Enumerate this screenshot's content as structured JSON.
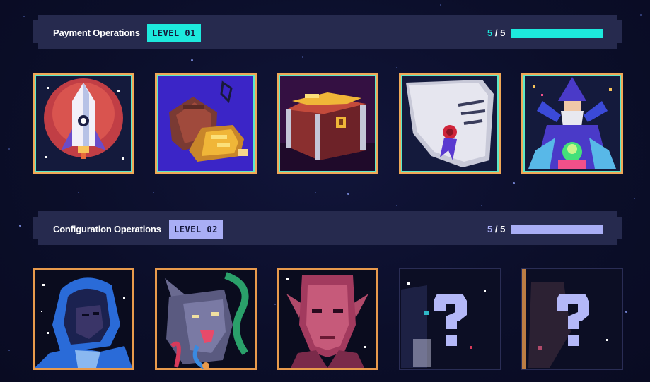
{
  "colors": {
    "background": "#0c0f2c",
    "bar": "#262a4e",
    "level1_accent": "#1de9dd",
    "level2_accent": "#a9aef5",
    "card_border_orange": "#e89a4c"
  },
  "sections": [
    {
      "title": "Payment Operations",
      "level_label": "LEVEL 01",
      "progress_current": "5",
      "progress_total": "/ 5",
      "progress_fraction": 1.0,
      "cards": [
        {
          "icon": "rocket-icon"
        },
        {
          "icon": "bag-of-gold-icon"
        },
        {
          "icon": "treasure-chest-icon"
        },
        {
          "icon": "scroll-icon"
        },
        {
          "icon": "wizard-icon"
        }
      ]
    },
    {
      "title": "Configuration Operations",
      "level_label": "LEVEL 02",
      "progress_current": "5",
      "progress_total": "/ 5",
      "progress_fraction": 1.0,
      "cards": [
        {
          "icon": "astronaut-portrait-icon"
        },
        {
          "icon": "wolf-warrior-portrait-icon"
        },
        {
          "icon": "elf-portrait-icon"
        },
        {
          "icon": "mystery-question-icon"
        },
        {
          "icon": "mystery-question-icon"
        }
      ]
    }
  ]
}
